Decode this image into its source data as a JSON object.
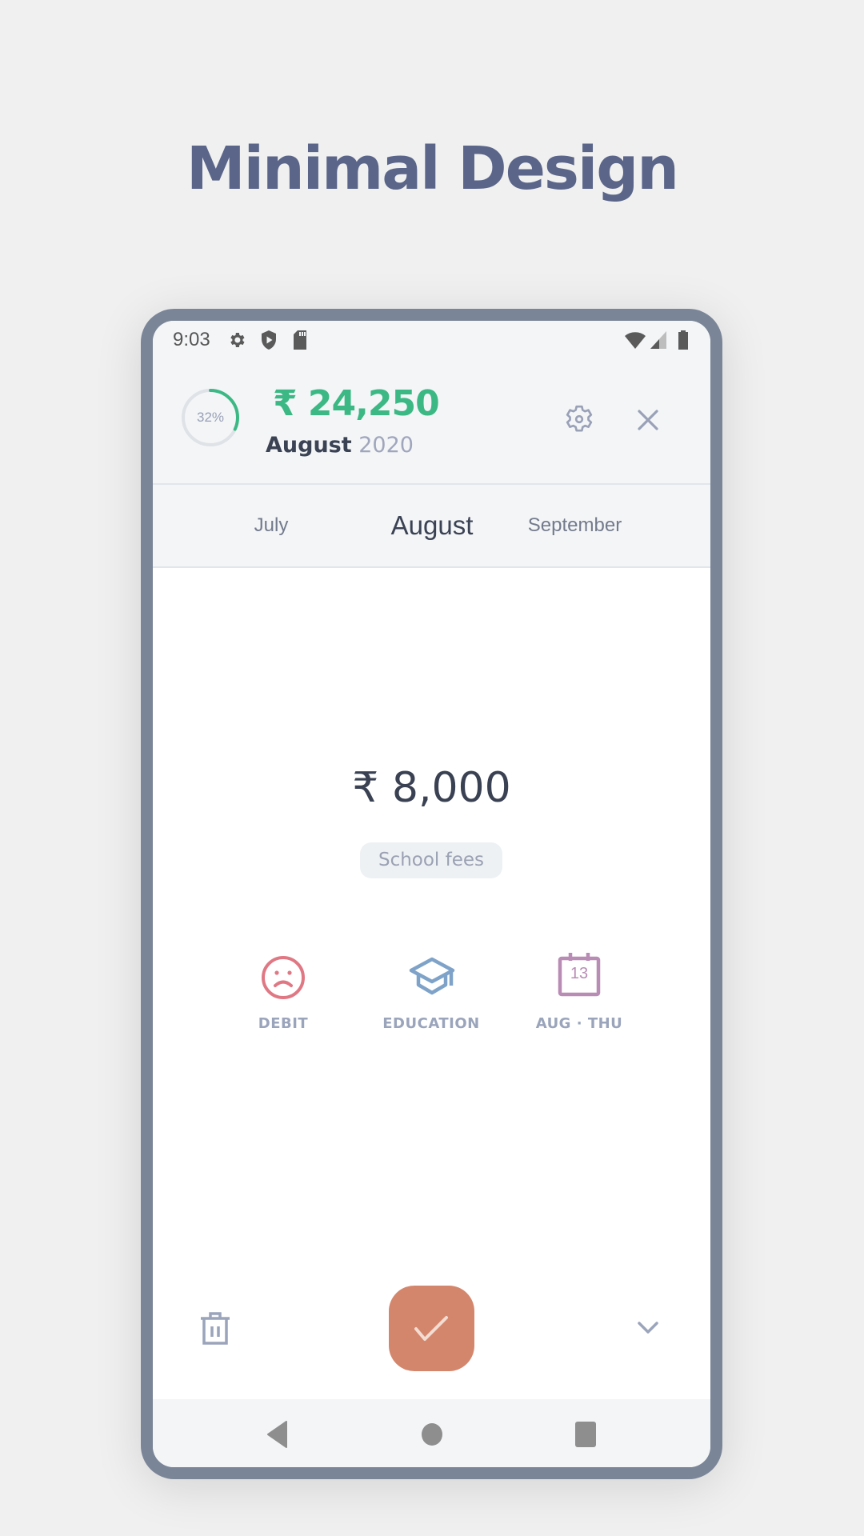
{
  "page_title": "Minimal Design",
  "status_bar": {
    "time": "9:03",
    "left_icons": [
      "gear-icon",
      "shield-play-icon",
      "sd-card-icon"
    ],
    "right_icons": [
      "wifi-icon",
      "signal-icon",
      "battery-icon"
    ]
  },
  "header": {
    "progress_percent": 32,
    "progress_label": "32%",
    "total_amount": "₹ 24,250",
    "month": "August",
    "year": "2020",
    "accent_color": "#3cb884"
  },
  "month_tabs": [
    {
      "label": "July",
      "active": false
    },
    {
      "label": "August",
      "active": true
    },
    {
      "label": "September",
      "active": false
    }
  ],
  "transaction": {
    "amount": "₹ 8,000",
    "note": "School fees"
  },
  "attributes": [
    {
      "label": "DEBIT",
      "icon": "sad-face-icon",
      "color": "#e07884"
    },
    {
      "label": "EDUCATION",
      "icon": "graduation-cap-icon",
      "color": "#7fa3c8"
    },
    {
      "label": "AUG · THU",
      "icon": "calendar-icon",
      "color": "#b98cb6",
      "day": "13"
    }
  ],
  "actions": {
    "delete": "trash-icon",
    "confirm": "check-icon",
    "confirm_color": "#d4866c",
    "expand": "chevron-down-icon"
  },
  "nav": [
    "back-icon",
    "home-icon",
    "recents-icon"
  ]
}
